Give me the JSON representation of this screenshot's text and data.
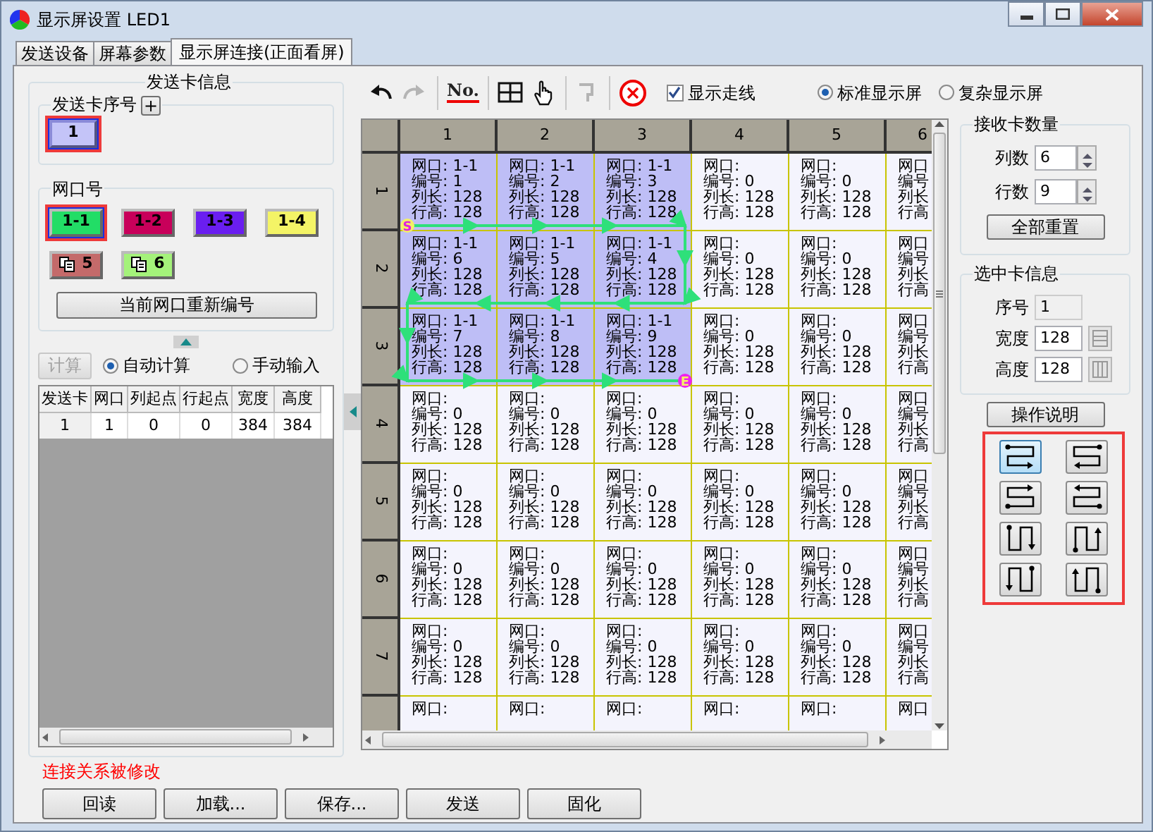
{
  "window": {
    "title": "显示屏设置 LED1"
  },
  "tabs": [
    {
      "label": "发送设备",
      "selected": false
    },
    {
      "label": "屏幕参数",
      "selected": false
    },
    {
      "label": "显示屏连接(正面看屏)",
      "selected": true
    }
  ],
  "sender_panel": {
    "title": "发送卡信息",
    "card_group": {
      "label": "发送卡序号",
      "add": "+",
      "cards": [
        {
          "label": "1",
          "selected": true
        }
      ]
    },
    "port_group": {
      "label": "网口号",
      "renumber_button": "当前网口重新编号",
      "ports": [
        {
          "label": "1-1",
          "color": "#22dd66",
          "kind": "plain",
          "selected": true
        },
        {
          "label": "1-2",
          "color": "#c8005a",
          "kind": "plain",
          "selected": false
        },
        {
          "label": "1-3",
          "color": "#6a1ef0",
          "kind": "plain",
          "selected": false
        },
        {
          "label": "1-4",
          "color": "#f4f466",
          "kind": "plain",
          "selected": false
        },
        {
          "label": "5",
          "color": "#c46a6a",
          "kind": "copy",
          "selected": false
        },
        {
          "label": "6",
          "color": "#a4f27a",
          "kind": "copy",
          "selected": false
        }
      ]
    },
    "calc_button": {
      "label": "计算",
      "disabled": true
    },
    "calc_modes": [
      {
        "label": "自动计算",
        "selected": true
      },
      {
        "label": "手动输入",
        "selected": false
      }
    ],
    "table": {
      "columns": [
        "发送卡",
        "网口",
        "列起点",
        "行起点",
        "宽度",
        "高度"
      ],
      "rows": [
        [
          "1",
          "1",
          "0",
          "0",
          "384",
          "384"
        ]
      ]
    }
  },
  "toolbar": {
    "tools": [
      {
        "kind": "undo",
        "disabled": false
      },
      {
        "kind": "redo",
        "disabled": true
      },
      {
        "kind": "number",
        "label": "No.",
        "disabled": false
      },
      {
        "kind": "grid",
        "disabled": false
      },
      {
        "kind": "hand",
        "disabled": false
      },
      {
        "kind": "bracket",
        "disabled": true
      },
      {
        "kind": "clear",
        "disabled": false
      }
    ],
    "show_route": {
      "label": "显示走线",
      "checked": true
    },
    "screen_types": [
      {
        "label": "标准显示屏",
        "selected": true
      },
      {
        "label": "复杂显示屏",
        "selected": false
      }
    ]
  },
  "grid": {
    "column_headers": [
      "1",
      "2",
      "3",
      "4",
      "5",
      "6"
    ],
    "row_headers": [
      "1",
      "2",
      "3",
      "4",
      "5",
      "6",
      "7"
    ],
    "route": {
      "start": "S",
      "end": "E"
    },
    "rows": [
      [
        {
          "lines": [
            "网口: 1-1",
            "编号: 1",
            "列长: 128",
            "行高: 128"
          ],
          "assigned": true
        },
        {
          "lines": [
            "网口: 1-1",
            "编号: 2",
            "列长: 128",
            "行高: 128"
          ],
          "assigned": true
        },
        {
          "lines": [
            "网口: 1-1",
            "编号: 3",
            "列长: 128",
            "行高: 128"
          ],
          "assigned": true
        },
        {
          "lines": [
            "网口:",
            "编号: 0",
            "列长: 128",
            "行高: 128"
          ],
          "assigned": false
        },
        {
          "lines": [
            "网口:",
            "编号: 0",
            "列长: 128",
            "行高: 128"
          ],
          "assigned": false
        },
        {
          "lines": [
            "网口",
            "编号",
            "列长",
            "行高"
          ],
          "assigned": false
        }
      ],
      [
        {
          "lines": [
            "网口: 1-1",
            "编号: 6",
            "列长: 128",
            "行高: 128"
          ],
          "assigned": true
        },
        {
          "lines": [
            "网口: 1-1",
            "编号: 5",
            "列长: 128",
            "行高: 128"
          ],
          "assigned": true
        },
        {
          "lines": [
            "网口: 1-1",
            "编号: 4",
            "列长: 128",
            "行高: 128"
          ],
          "assigned": true
        },
        {
          "lines": [
            "网口:",
            "编号: 0",
            "列长: 128",
            "行高: 128"
          ],
          "assigned": false
        },
        {
          "lines": [
            "网口:",
            "编号: 0",
            "列长: 128",
            "行高: 128"
          ],
          "assigned": false
        },
        {
          "lines": [
            "网口",
            "编号",
            "列长",
            "行高"
          ],
          "assigned": false
        }
      ],
      [
        {
          "lines": [
            "网口: 1-1",
            "编号: 7",
            "列长: 128",
            "行高: 128"
          ],
          "assigned": true
        },
        {
          "lines": [
            "网口: 1-1",
            "编号: 8",
            "列长: 128",
            "行高: 128"
          ],
          "assigned": true
        },
        {
          "lines": [
            "网口: 1-1",
            "编号: 9",
            "列长: 128",
            "行高: 128"
          ],
          "assigned": true
        },
        {
          "lines": [
            "网口:",
            "编号: 0",
            "列长: 128",
            "行高: 128"
          ],
          "assigned": false
        },
        {
          "lines": [
            "网口:",
            "编号: 0",
            "列长: 128",
            "行高: 128"
          ],
          "assigned": false
        },
        {
          "lines": [
            "网口",
            "编号",
            "列长",
            "行高"
          ],
          "assigned": false
        }
      ],
      [
        {
          "lines": [
            "网口:",
            "编号: 0",
            "列长: 128",
            "行高: 128"
          ],
          "assigned": false
        },
        {
          "lines": [
            "网口:",
            "编号: 0",
            "列长: 128",
            "行高: 128"
          ],
          "assigned": false
        },
        {
          "lines": [
            "网口:",
            "编号: 0",
            "列长: 128",
            "行高: 128"
          ],
          "assigned": false
        },
        {
          "lines": [
            "网口:",
            "编号: 0",
            "列长: 128",
            "行高: 128"
          ],
          "assigned": false
        },
        {
          "lines": [
            "网口:",
            "编号: 0",
            "列长: 128",
            "行高: 128"
          ],
          "assigned": false
        },
        {
          "lines": [
            "网口",
            "编号",
            "列长",
            "行高"
          ],
          "assigned": false
        }
      ],
      [
        {
          "lines": [
            "网口:",
            "编号: 0",
            "列长: 128",
            "行高: 128"
          ],
          "assigned": false
        },
        {
          "lines": [
            "网口:",
            "编号: 0",
            "列长: 128",
            "行高: 128"
          ],
          "assigned": false
        },
        {
          "lines": [
            "网口:",
            "编号: 0",
            "列长: 128",
            "行高: 128"
          ],
          "assigned": false
        },
        {
          "lines": [
            "网口:",
            "编号: 0",
            "列长: 128",
            "行高: 128"
          ],
          "assigned": false
        },
        {
          "lines": [
            "网口:",
            "编号: 0",
            "列长: 128",
            "行高: 128"
          ],
          "assigned": false
        },
        {
          "lines": [
            "网口",
            "编号",
            "列长",
            "行高"
          ],
          "assigned": false
        }
      ],
      [
        {
          "lines": [
            "网口:",
            "编号: 0",
            "列长: 128",
            "行高: 128"
          ],
          "assigned": false
        },
        {
          "lines": [
            "网口:",
            "编号: 0",
            "列长: 128",
            "行高: 128"
          ],
          "assigned": false
        },
        {
          "lines": [
            "网口:",
            "编号: 0",
            "列长: 128",
            "行高: 128"
          ],
          "assigned": false
        },
        {
          "lines": [
            "网口:",
            "编号: 0",
            "列长: 128",
            "行高: 128"
          ],
          "assigned": false
        },
        {
          "lines": [
            "网口:",
            "编号: 0",
            "列长: 128",
            "行高: 128"
          ],
          "assigned": false
        },
        {
          "lines": [
            "网口",
            "编号",
            "列长",
            "行高"
          ],
          "assigned": false
        }
      ],
      [
        {
          "lines": [
            "网口:",
            "编号: 0",
            "列长: 128",
            "行高: 128"
          ],
          "assigned": false
        },
        {
          "lines": [
            "网口:",
            "编号: 0",
            "列长: 128",
            "行高: 128"
          ],
          "assigned": false
        },
        {
          "lines": [
            "网口:",
            "编号: 0",
            "列长: 128",
            "行高: 128"
          ],
          "assigned": false
        },
        {
          "lines": [
            "网口:",
            "编号: 0",
            "列长: 128",
            "行高: 128"
          ],
          "assigned": false
        },
        {
          "lines": [
            "网口:",
            "编号: 0",
            "列长: 128",
            "行高: 128"
          ],
          "assigned": false
        },
        {
          "lines": [
            "网口",
            "编号",
            "列长",
            "行高"
          ],
          "assigned": false
        }
      ],
      [
        {
          "lines": [
            "网口:"
          ],
          "assigned": false
        },
        {
          "lines": [
            "网口:"
          ],
          "assigned": false
        },
        {
          "lines": [
            "网口:"
          ],
          "assigned": false
        },
        {
          "lines": [
            "网口:"
          ],
          "assigned": false
        },
        {
          "lines": [
            "网口:"
          ],
          "assigned": false
        },
        {
          "lines": [
            "网口"
          ],
          "assigned": false
        }
      ]
    ]
  },
  "receiver_count": {
    "title": "接收卡数量",
    "fields": [
      {
        "label": "列数",
        "value": "6"
      },
      {
        "label": "行数",
        "value": "9"
      }
    ],
    "reset_button": "全部重置"
  },
  "selected_card": {
    "title": "选中卡信息",
    "fields": [
      {
        "label": "序号",
        "value": "1",
        "kind": "readonly"
      },
      {
        "label": "宽度",
        "value": "128",
        "kind": "width"
      },
      {
        "label": "高度",
        "value": "128",
        "kind": "height"
      }
    ]
  },
  "help_button": "操作说明",
  "wiring_modes": [
    {
      "kind": "horizontal-topleft",
      "selected": true
    },
    {
      "kind": "horizontal-topright",
      "selected": false
    },
    {
      "kind": "horizontal-bottomleft",
      "selected": false
    },
    {
      "kind": "horizontal-bottomright",
      "selected": false
    },
    {
      "kind": "vertical-topleft",
      "selected": false
    },
    {
      "kind": "vertical-bottomleft",
      "selected": false
    },
    {
      "kind": "vertical-topright",
      "selected": false
    },
    {
      "kind": "vertical-bottomright",
      "selected": false
    }
  ],
  "status_message": "连接关系被修改",
  "buttons": [
    "回读",
    "加载...",
    "保存...",
    "发送",
    "固化"
  ]
}
